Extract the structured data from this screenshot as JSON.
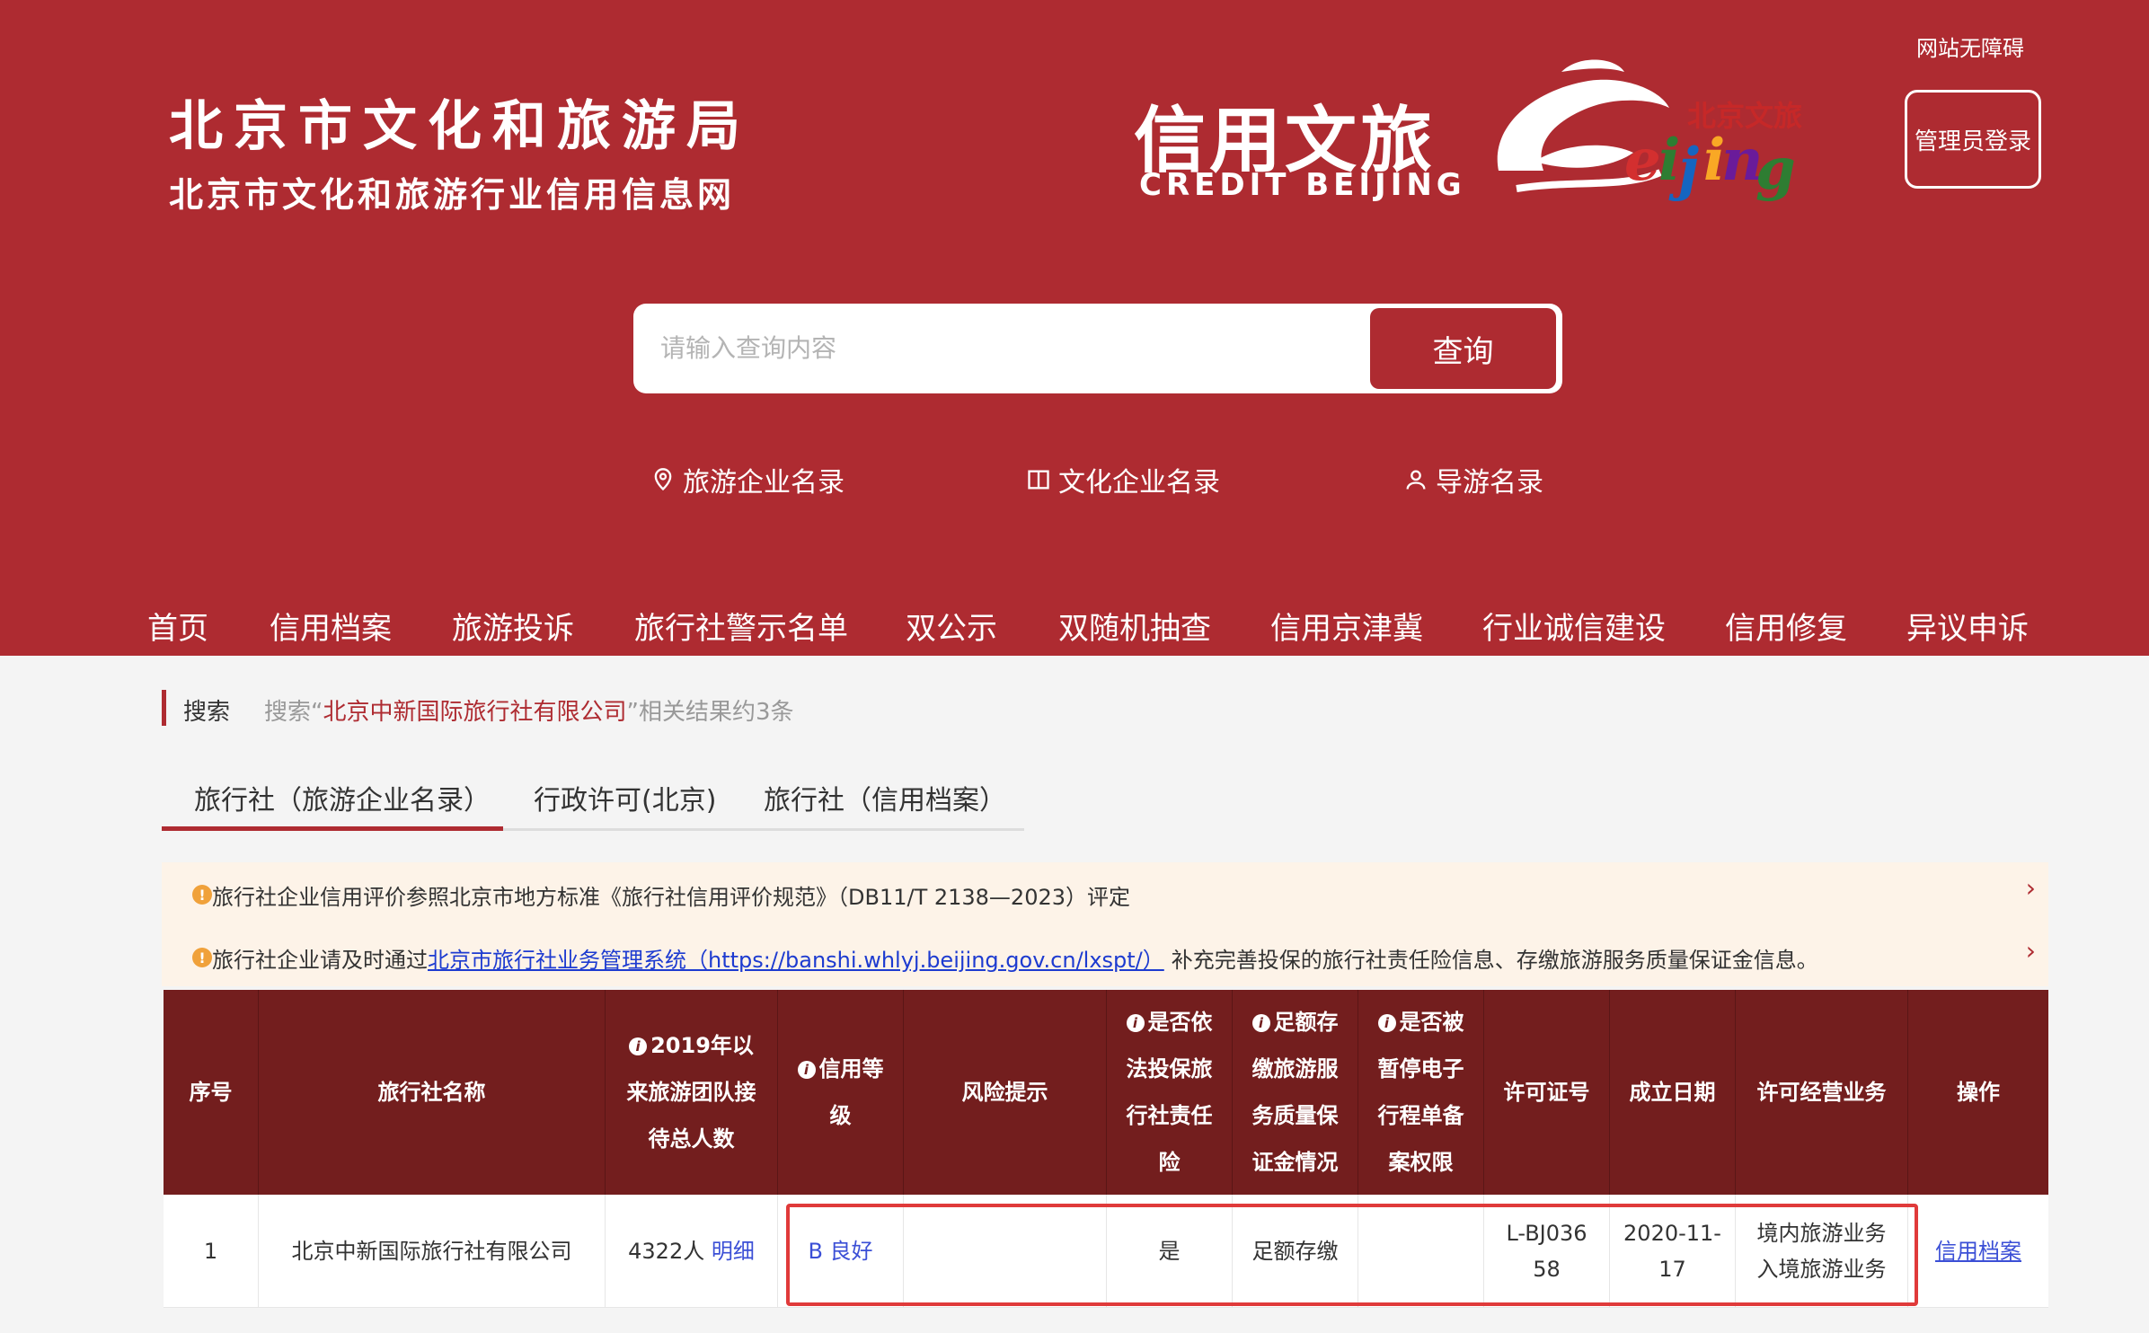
{
  "header": {
    "accessibility": "网站无障碍",
    "title_main": "北京市文化和旅游局",
    "title_sub": "北京市文化和旅游行业信用信息网",
    "credit_cn": "信用文旅",
    "credit_en": "CREDIT BEIJING",
    "admin_login": "管理员登录",
    "brand_color": "#ae2b31"
  },
  "search": {
    "placeholder": "请输入查询内容",
    "button": "查询"
  },
  "directories": [
    {
      "label": "旅游企业名录",
      "icon": "location-pin-icon"
    },
    {
      "label": "文化企业名录",
      "icon": "book-icon"
    },
    {
      "label": "导游名录",
      "icon": "user-icon"
    }
  ],
  "nav": [
    "首页",
    "信用档案",
    "旅游投诉",
    "旅行社警示名单",
    "双公示",
    "双随机抽查",
    "信用京津冀",
    "行业诚信建设",
    "信用修复",
    "异议申诉"
  ],
  "breadcrumb": {
    "label": "搜索",
    "prefix": "搜索“",
    "keyword": "北京中新国际旅行社有限公司",
    "suffix": "”相关结果约3条"
  },
  "tabs": [
    "旅行社（旅游企业名录）",
    "行政许可(北京)",
    "旅行社（信用档案）"
  ],
  "notices": [
    {
      "text": "旅行社企业信用评价参照北京市地方标准《旅行社信用评价规范》（DB11/T 2138—2023）评定"
    },
    {
      "before": "旅行社企业请及时通过",
      "link": "北京市旅行社业务管理系统（https://banshi.whlyj.beijing.gov.cn/lxspt/）",
      "after": "补充完善投保的旅行社责任险信息、存缴旅游服务质量保证金信息。"
    }
  ],
  "table": {
    "headers": [
      "序号",
      "旅行社名称",
      "2019年以来旅游团队接待总人数",
      "信用等级",
      "风险提示",
      "是否依法投保旅行社责任险",
      "足额存缴旅游服务质量保证金情况",
      "是否被暂停电子行程单备案权限",
      "许可证号",
      "成立日期",
      "许可经营业务",
      "操作"
    ],
    "rows": [
      {
        "index": "1",
        "name": "北京中新国际旅行社有限公司",
        "visitors": "4322人",
        "detail_link": "明细",
        "credit_level": "B 良好",
        "risk": "",
        "insured": "是",
        "deposit": "足额存缴",
        "suspended": "",
        "license_line1": "L-BJ036",
        "license_line2": "58",
        "date_line1": "2020-11-",
        "date_line2": "17",
        "business_line1": "境内旅游业务",
        "business_line2": "入境旅游业务",
        "action": "信用档案"
      }
    ]
  },
  "accent_colors": {
    "table_header": "#731e1e",
    "notice_bg": "#fdf3e8",
    "highlight": "#e03a3a",
    "link": "#3b4fd6"
  }
}
